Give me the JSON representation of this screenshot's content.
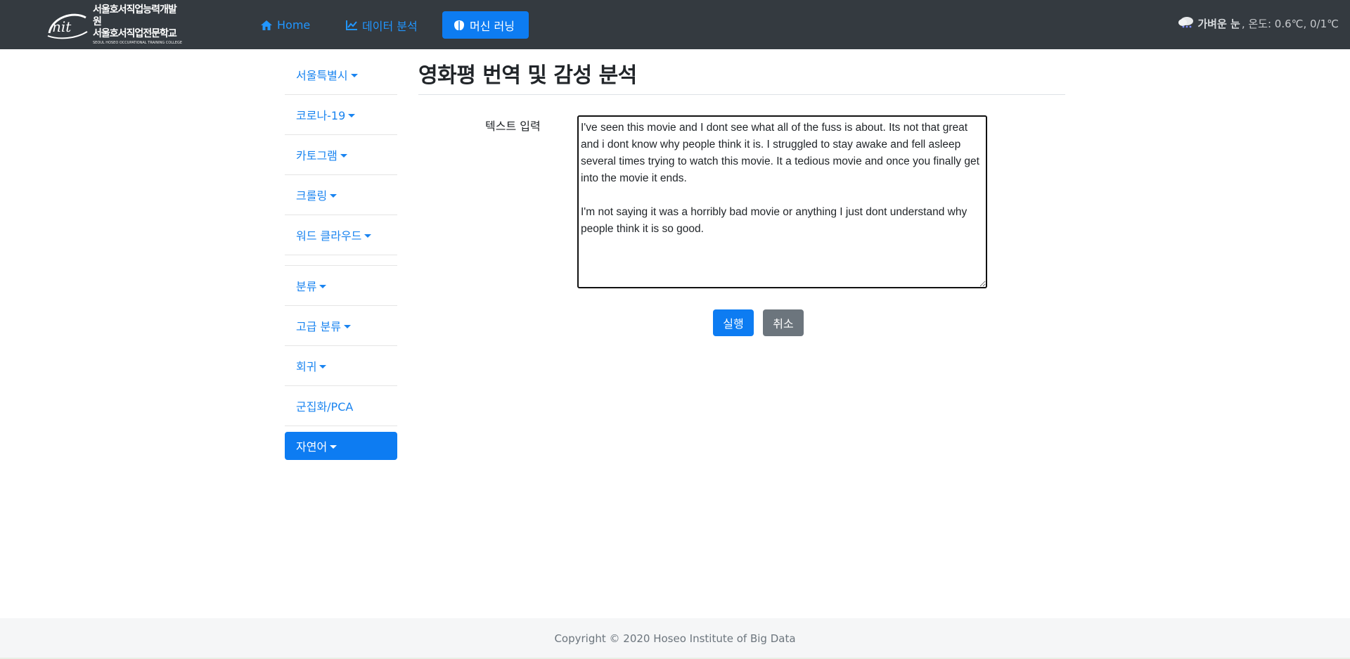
{
  "brand": {
    "line1": "서울호서직업능력개발원",
    "line2": "서울호서직업전문학교",
    "line3": "SEOUL HOSEO OCCUPATIONAL TRAINING COLLEGE"
  },
  "nav": {
    "home": "Home",
    "data_analysis": "데이터 분석",
    "machine_learning": "머신 러닝"
  },
  "weather": {
    "icon": "cloud-snow-icon",
    "condition": "가벼운 눈",
    "details": ", 온도: 0.6℃, 0/1℃"
  },
  "sidebar": {
    "items": [
      {
        "label": "서울특별시",
        "dropdown": true
      },
      {
        "label": "코로나-19",
        "dropdown": true
      },
      {
        "label": "카토그램",
        "dropdown": true
      },
      {
        "label": "크롤링",
        "dropdown": true
      },
      {
        "label": "워드 클라우드",
        "dropdown": true
      },
      {
        "label": "분류",
        "dropdown": true
      },
      {
        "label": "고급 분류",
        "dropdown": true
      },
      {
        "label": "회귀",
        "dropdown": true
      },
      {
        "label": "군집화/PCA",
        "dropdown": false
      },
      {
        "label": "자연어",
        "dropdown": true,
        "active": true
      }
    ]
  },
  "main": {
    "title": "영화평 번역 및 감성 분석",
    "input_label": "텍스트 입력",
    "input_value": "I've seen this movie and I dont see what all of the fuss is about. Its not that great and i dont know why people think it is. I struggled to stay awake and fell asleep several times trying to watch this movie. It a tedious movie and once you finally get into the movie it ends.\n\nI'm not saying it was a horribly bad movie or anything I just dont understand why people think it is so good.",
    "run_button": "실행",
    "cancel_button": "취소"
  },
  "footer": {
    "copyright": "Copyright © 2020 Hoseo Institute of Big Data"
  },
  "colors": {
    "navbar": "#343a40",
    "primary": "#0d7cf2",
    "link": "#1a84f0",
    "secondary": "#6c757d"
  }
}
